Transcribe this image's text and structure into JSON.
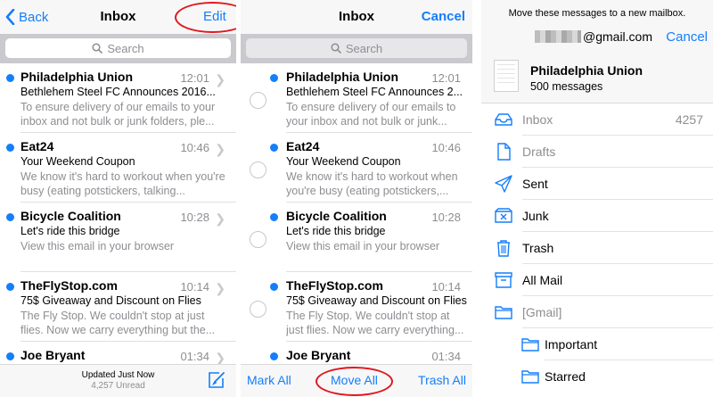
{
  "colors": {
    "accent": "#147efb",
    "annotation": "#e0171f",
    "unread_dot": "#147efb"
  },
  "panel1": {
    "nav": {
      "back_label": "Back",
      "title": "Inbox",
      "edit_label": "Edit"
    },
    "search_placeholder": "Search",
    "toolbar": {
      "status_line1": "Updated Just Now",
      "status_line2": "4,257 Unread"
    }
  },
  "panel2": {
    "nav": {
      "title": "Inbox",
      "cancel_label": "Cancel"
    },
    "search_placeholder": "Search",
    "toolbar": {
      "mark_all": "Mark All",
      "move_all": "Move All",
      "trash_all": "Trash All"
    }
  },
  "emails_p1": [
    {
      "sender": "Philadelphia Union",
      "time": "12:01",
      "subject": "Bethlehem Steel FC Announces 2016...",
      "preview": "To ensure delivery of our emails to your inbox and not bulk or junk folders, ple..."
    },
    {
      "sender": "Eat24",
      "time": "10:46",
      "subject": "Your Weekend Coupon",
      "preview": "We know it's hard to workout when you're busy (eating potstickers, talking..."
    },
    {
      "sender": "Bicycle Coalition",
      "time": "10:28",
      "subject": "Let's ride this bridge",
      "preview": "View this email in your browser"
    },
    {
      "sender": "TheFlyStop.com",
      "time": "10:14",
      "subject": "75$ Giveaway and Discount on Flies",
      "preview": "The Fly Stop. We couldn't stop at just flies. Now we carry everything but the..."
    },
    {
      "sender": "Joe Bryant",
      "time": "01:34",
      "subject": "",
      "preview": ""
    }
  ],
  "emails_p2": [
    {
      "sender": "Philadelphia Union",
      "time": "12:01",
      "subject": "Bethlehem Steel FC Announces 2...",
      "preview": "To ensure delivery of our emails to your inbox and not bulk or junk..."
    },
    {
      "sender": "Eat24",
      "time": "10:46",
      "subject": "Your Weekend Coupon",
      "preview": "We know it's hard to workout when you're busy (eating potstickers,..."
    },
    {
      "sender": "Bicycle Coalition",
      "time": "10:28",
      "subject": "Let's ride this bridge",
      "preview": "View this email in your browser"
    },
    {
      "sender": "TheFlyStop.com",
      "time": "10:14",
      "subject": "75$ Giveaway and Discount on Flies",
      "preview": "The Fly Stop. We couldn't stop at just flies. Now we carry everything..."
    },
    {
      "sender": "Joe Bryant",
      "time": "01:34",
      "subject": "",
      "preview": ""
    }
  ],
  "panel3": {
    "header": "Move these messages to a new mailbox.",
    "account_suffix": "@gmail.com",
    "cancel_label": "Cancel",
    "sender": "Philadelphia Union",
    "message_count": "500 messages",
    "mailboxes": [
      {
        "label": "Inbox",
        "count": "4257",
        "icon": "inbox-icon",
        "dim": true
      },
      {
        "label": "Drafts",
        "count": "",
        "icon": "drafts-icon",
        "dim": true
      },
      {
        "label": "Sent",
        "count": "",
        "icon": "sent-icon",
        "dim": false
      },
      {
        "label": "Junk",
        "count": "",
        "icon": "junk-icon",
        "dim": false
      },
      {
        "label": "Trash",
        "count": "",
        "icon": "trash-icon",
        "dim": false
      },
      {
        "label": "All Mail",
        "count": "",
        "icon": "archive-icon",
        "dim": false
      },
      {
        "label": "[Gmail]",
        "count": "",
        "icon": "folder-icon",
        "dim": true
      },
      {
        "label": "Important",
        "count": "",
        "icon": "folder-icon",
        "dim": false,
        "sub": true
      },
      {
        "label": "Starred",
        "count": "",
        "icon": "folder-icon",
        "dim": false,
        "sub": true
      }
    ]
  }
}
